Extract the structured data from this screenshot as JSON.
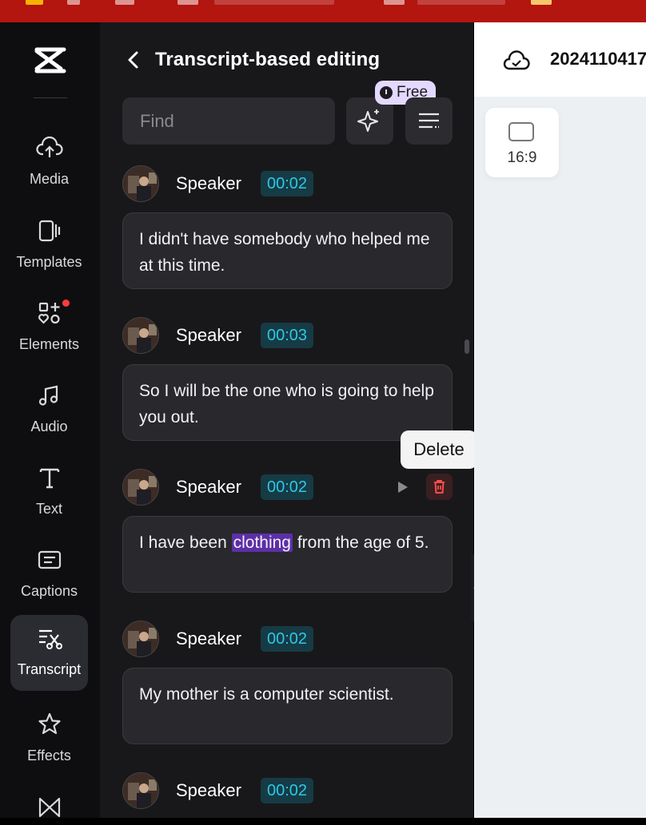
{
  "panel": {
    "title": "Transcript-based editing",
    "find_placeholder": "Find",
    "free_label": "Free"
  },
  "nav": {
    "items": [
      {
        "label": "Media",
        "icon": "cloud-upload-icon"
      },
      {
        "label": "Templates",
        "icon": "templates-icon"
      },
      {
        "label": "Elements",
        "icon": "elements-icon"
      },
      {
        "label": "Audio",
        "icon": "music-note-icon"
      },
      {
        "label": "Text",
        "icon": "text-icon"
      },
      {
        "label": "Captions",
        "icon": "captions-icon"
      },
      {
        "label": "Transcript",
        "icon": "transcript-icon"
      },
      {
        "label": "Effects",
        "icon": "effects-icon"
      }
    ],
    "active": "Transcript"
  },
  "entries": [
    {
      "speaker": "Speaker",
      "time": "00:02",
      "text": "I didn't have somebody who helped me at this time."
    },
    {
      "speaker": "Speaker",
      "time": "00:03",
      "text": "So I will be the one who is going to help you out."
    },
    {
      "speaker": "Speaker",
      "time": "00:02",
      "text_before": "I have been ",
      "highlight": "clothing",
      "text_after": " from the age of 5."
    },
    {
      "speaker": "Speaker",
      "time": "00:02",
      "text": "My mother is a computer scientist."
    },
    {
      "speaker": "Speaker",
      "time": "00:02"
    }
  ],
  "tooltip": {
    "delete": "Delete"
  },
  "editor": {
    "project_name": "2024110417",
    "ratio": "16:9"
  },
  "colors": {
    "accent_time": "#2ec7e6",
    "highlight": "#5d2fa8",
    "delete_red": "#ff4d4d",
    "badge_red": "#ff3b3b"
  }
}
